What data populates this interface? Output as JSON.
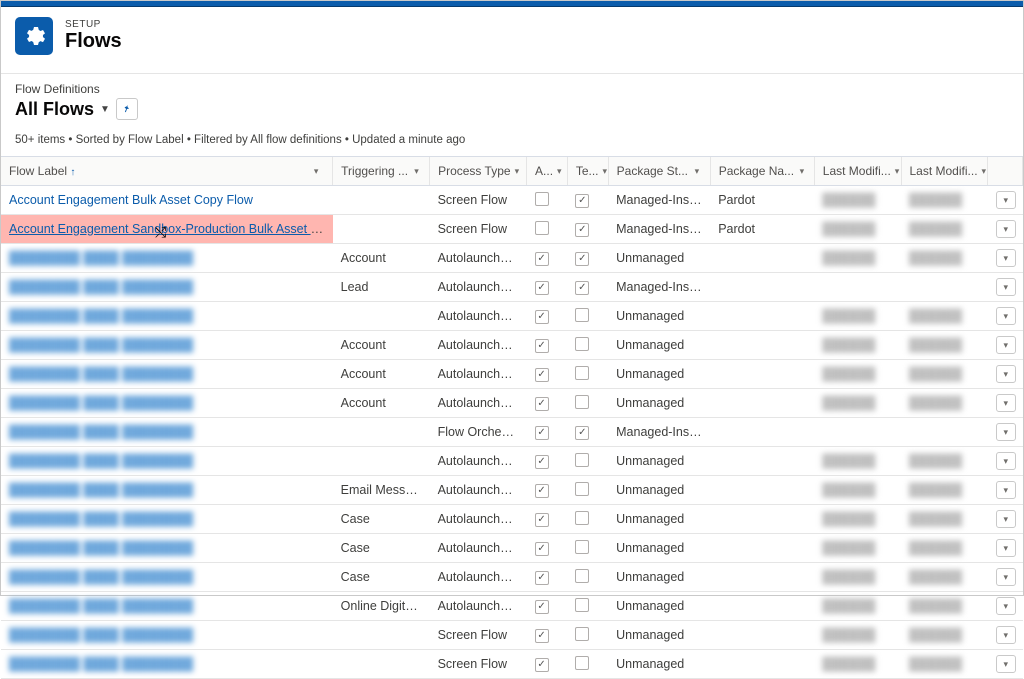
{
  "header": {
    "setup_label": "SETUP",
    "page_title": "Flows"
  },
  "listview": {
    "subtitle": "Flow Definitions",
    "title": "All Flows",
    "meta": "50+ items • Sorted by Flow Label • Filtered by All flow definitions • Updated a minute ago"
  },
  "columns": {
    "flow_label": "Flow Label",
    "triggering": "Triggering ...",
    "process_type": "Process Type",
    "a": "A...",
    "te": "Te...",
    "package_state": "Package St...",
    "package_name": "Package Na...",
    "last_modified_by": "Last Modifi...",
    "last_modified_date": "Last Modifi..."
  },
  "rows": [
    {
      "label": "Account Engagement Bulk Asset Copy Flow",
      "trig": "",
      "proc": "Screen Flow",
      "a": false,
      "te": true,
      "pst": "Managed-Instal...",
      "pna": "Pardot",
      "lm1": "blur",
      "lm2": "blur",
      "blurLabel": false,
      "hl": false
    },
    {
      "label": "Account Engagement Sandbox-Production Bulk Asset Copy Flow",
      "trig": "",
      "proc": "Screen Flow",
      "a": false,
      "te": true,
      "pst": "Managed-Instal...",
      "pna": "Pardot",
      "lm1": "blur",
      "lm2": "blur",
      "blurLabel": false,
      "hl": true
    },
    {
      "label": "blurred label 1",
      "trig": "Account",
      "proc": "Autolaunched F...",
      "a": true,
      "te": true,
      "pst": "Unmanaged",
      "pna": "",
      "lm1": "blur",
      "lm2": "blur",
      "blurLabel": true,
      "hl": false
    },
    {
      "label": "blurred label 2",
      "trig": "Lead",
      "proc": "Autolaunched F...",
      "a": true,
      "te": true,
      "pst": "Managed-Instal...",
      "pna": "",
      "lm1": "",
      "lm2": "",
      "blurLabel": true,
      "hl": false
    },
    {
      "label": "blurred label 3",
      "trig": "",
      "proc": "Autolaunched F...",
      "a": true,
      "te": false,
      "pst": "Unmanaged",
      "pna": "",
      "lm1": "blur",
      "lm2": "blur",
      "blurLabel": true,
      "hl": false
    },
    {
      "label": "blurred label 4",
      "trig": "Account",
      "proc": "Autolaunched F...",
      "a": true,
      "te": false,
      "pst": "Unmanaged",
      "pna": "",
      "lm1": "blur",
      "lm2": "blur",
      "blurLabel": true,
      "hl": false
    },
    {
      "label": "blurred label 5",
      "trig": "Account",
      "proc": "Autolaunched F...",
      "a": true,
      "te": false,
      "pst": "Unmanaged",
      "pna": "",
      "lm1": "blur",
      "lm2": "blur",
      "blurLabel": true,
      "hl": false
    },
    {
      "label": "blurred label 6",
      "trig": "Account",
      "proc": "Autolaunched F...",
      "a": true,
      "te": false,
      "pst": "Unmanaged",
      "pna": "",
      "lm1": "blur",
      "lm2": "blur",
      "blurLabel": true,
      "hl": false
    },
    {
      "label": "blurred label 7",
      "trig": "",
      "proc": "Flow Orchestrat...",
      "a": true,
      "te": true,
      "pst": "Managed-Instal...",
      "pna": "",
      "lm1": "",
      "lm2": "",
      "blurLabel": true,
      "hl": false
    },
    {
      "label": "blurred label 8",
      "trig": "",
      "proc": "Autolaunched F...",
      "a": true,
      "te": false,
      "pst": "Unmanaged",
      "pna": "",
      "lm1": "blur",
      "lm2": "blur",
      "blurLabel": true,
      "hl": false
    },
    {
      "label": "blurred label 9",
      "trig": "Email Message",
      "proc": "Autolaunched F...",
      "a": true,
      "te": false,
      "pst": "Unmanaged",
      "pna": "",
      "lm1": "blur",
      "lm2": "blur",
      "blurLabel": true,
      "hl": false
    },
    {
      "label": "blurred label 10",
      "trig": "Case",
      "proc": "Autolaunched F...",
      "a": true,
      "te": false,
      "pst": "Unmanaged",
      "pna": "",
      "lm1": "blur",
      "lm2": "blur",
      "blurLabel": true,
      "hl": false
    },
    {
      "label": "blurred label 11",
      "trig": "Case",
      "proc": "Autolaunched F...",
      "a": true,
      "te": false,
      "pst": "Unmanaged",
      "pna": "",
      "lm1": "blur",
      "lm2": "blur",
      "blurLabel": true,
      "hl": false
    },
    {
      "label": "blurred label 12",
      "trig": "Case",
      "proc": "Autolaunched F...",
      "a": true,
      "te": false,
      "pst": "Unmanaged",
      "pna": "",
      "lm1": "blur",
      "lm2": "blur",
      "blurLabel": true,
      "hl": false
    },
    {
      "label": "blurred label 13",
      "trig": "Online Digital P...",
      "proc": "Autolaunched F...",
      "a": true,
      "te": false,
      "pst": "Unmanaged",
      "pna": "",
      "lm1": "blur",
      "lm2": "blur",
      "blurLabel": true,
      "hl": false
    },
    {
      "label": "blurred label 14",
      "trig": "",
      "proc": "Screen Flow",
      "a": true,
      "te": false,
      "pst": "Unmanaged",
      "pna": "",
      "lm1": "blur",
      "lm2": "blur",
      "blurLabel": true,
      "hl": false
    },
    {
      "label": "blurred label 15",
      "trig": "",
      "proc": "Screen Flow",
      "a": true,
      "te": false,
      "pst": "Unmanaged",
      "pna": "",
      "lm1": "blur",
      "lm2": "blur",
      "blurLabel": true,
      "hl": false
    }
  ]
}
